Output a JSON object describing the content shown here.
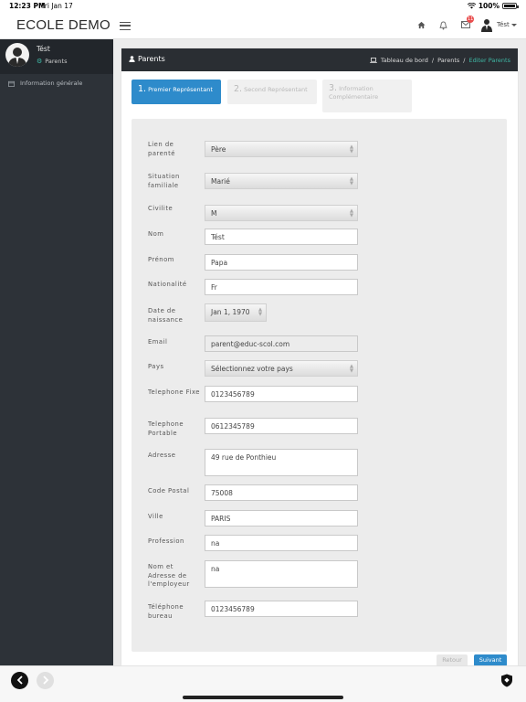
{
  "status": {
    "time": "12:23 PM",
    "date": "Fri Jan 17",
    "battery": "100%"
  },
  "topbar": {
    "brand": "ECOLE DEMO",
    "notification_count": "11",
    "user_name": "Tést"
  },
  "sidebar": {
    "user_name": "Tést",
    "user_role": "Parents",
    "menu": [
      {
        "label": "Information générale",
        "icon": "calendar-icon"
      }
    ]
  },
  "page": {
    "title": "Parents",
    "breadcrumb": [
      "Tableau de bord",
      "Parents",
      "Editer Parents"
    ],
    "separator": "/"
  },
  "steps": [
    {
      "num": "1.",
      "label": "Premier Représentant",
      "active": true
    },
    {
      "num": "2.",
      "label": "Second Représentant",
      "active": false
    },
    {
      "num": "3.",
      "label": "Information Complémentaire",
      "active": false
    }
  ],
  "form": {
    "lien_label": "Lien de parenté",
    "lien_value": "Père",
    "situation_label": "Situation familiale",
    "situation_value": "Marié",
    "civilite_label": "Civilite",
    "civilite_value": "M",
    "nom_label": "Nom",
    "nom_value": "Tést",
    "prenom_label": "Prénom",
    "prenom_value": "Papa",
    "nationalite_label": "Nationalité",
    "nationalite_value": "Fr",
    "naissance_label": "Date de naissance",
    "naissance_value": "Jan 1, 1970",
    "email_label": "Email",
    "email_value": "parent@educ-scol.com",
    "pays_label": "Pays",
    "pays_value": "Sélectionnez votre pays",
    "tel_fixe_label": "Telephone Fixe",
    "tel_fixe_value": "0123456789",
    "tel_portable_label": "Telephone Portable",
    "tel_portable_value": "0612345789",
    "adresse_label": "Adresse",
    "adresse_value": "49 rue de Ponthieu",
    "code_postal_label": "Code Postal",
    "code_postal_value": "75008",
    "ville_label": "Ville",
    "ville_value": "PARIS",
    "profession_label": "Profession",
    "profession_value": "na",
    "employeur_label": "Nom et Adresse de l'employeur",
    "employeur_value": "na",
    "tel_bureau_label": "Téléphone bureau",
    "tel_bureau_value": "0123456789"
  },
  "buttons": {
    "back": "Retour",
    "next": "Suivant"
  },
  "colors": {
    "primary": "#2e8bcb",
    "accent": "#3fb9a6",
    "sidebar": "#2d3238",
    "header": "#2a2e33",
    "badge": "#e94e4e"
  }
}
